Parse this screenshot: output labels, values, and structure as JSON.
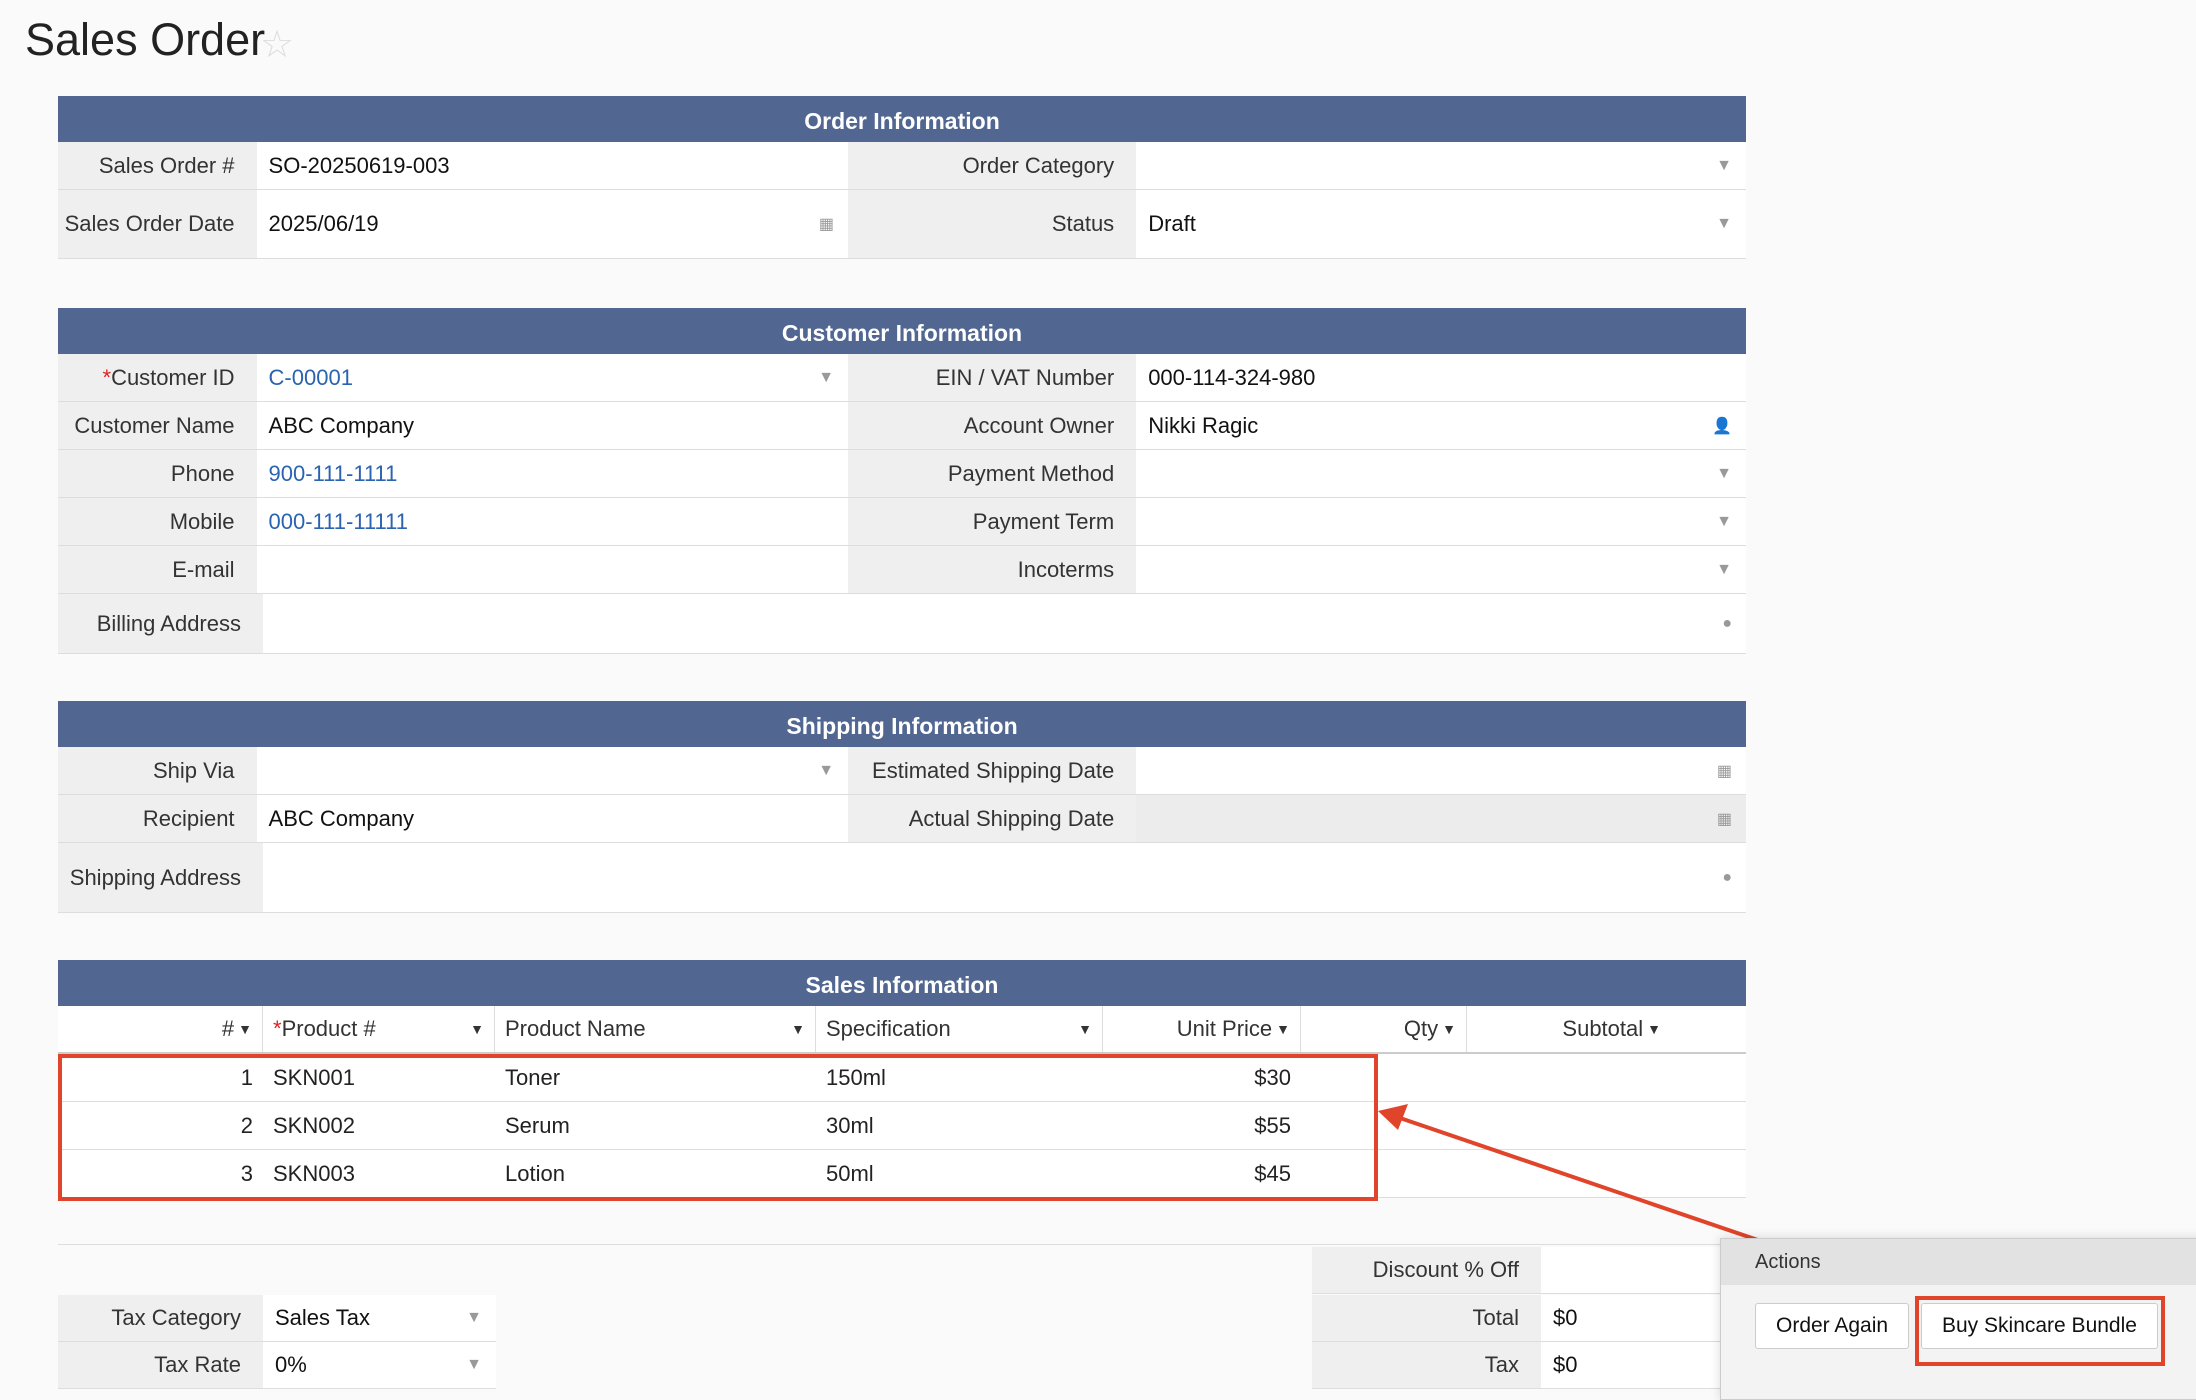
{
  "page": {
    "title": "Sales Order"
  },
  "order_info": {
    "header": "Order Information",
    "sales_order_no_label": "Sales Order #",
    "sales_order_no": "SO-20250619-003",
    "order_category_label": "Order Category",
    "order_category": "",
    "sales_order_date_label": "Sales Order Date",
    "sales_order_date": "2025/06/19",
    "status_label": "Status",
    "status": "Draft"
  },
  "customer_info": {
    "header": "Customer Information",
    "customer_id_label": "Customer ID",
    "customer_id": "C-00001",
    "ein_label": "EIN / VAT Number",
    "ein": "000-114-324-980",
    "customer_name_label": "Customer Name",
    "customer_name": "ABC Company",
    "account_owner_label": "Account Owner",
    "account_owner": "Nikki Ragic",
    "phone_label": "Phone",
    "phone": "900-111-1111",
    "payment_method_label": "Payment Method",
    "payment_method": "",
    "mobile_label": "Mobile",
    "mobile": "000-111-11111",
    "payment_term_label": "Payment Term",
    "payment_term": "",
    "email_label": "E-mail",
    "email": "",
    "incoterms_label": "Incoterms",
    "incoterms": "",
    "billing_address_label": "Billing Address",
    "billing_address": ""
  },
  "shipping_info": {
    "header": "Shipping Information",
    "ship_via_label": "Ship Via",
    "ship_via": "",
    "est_ship_date_label": "Estimated Shipping Date",
    "est_ship_date": "",
    "recipient_label": "Recipient",
    "recipient": "ABC Company",
    "actual_ship_date_label": "Actual Shipping Date",
    "actual_ship_date": "",
    "shipping_address_label": "Shipping Address",
    "shipping_address": ""
  },
  "sales_info": {
    "header": "Sales Information",
    "columns": [
      "#",
      "Product #",
      "Product Name",
      "Specification",
      "Unit Price",
      "Qty",
      "Subtotal"
    ],
    "rows": [
      {
        "no": "1",
        "product_no": "SKN001",
        "name": "Toner",
        "spec": "150ml",
        "price": "$30",
        "qty": "",
        "subtotal": ""
      },
      {
        "no": "2",
        "product_no": "SKN002",
        "name": "Serum",
        "spec": "30ml",
        "price": "$55",
        "qty": "",
        "subtotal": ""
      },
      {
        "no": "3",
        "product_no": "SKN003",
        "name": "Lotion",
        "spec": "50ml",
        "price": "$45",
        "qty": "",
        "subtotal": ""
      }
    ]
  },
  "totals": {
    "tax_category_label": "Tax Category",
    "tax_category": "Sales Tax",
    "tax_rate_label": "Tax Rate",
    "tax_rate": "0%",
    "discount_label": "Discount % Off",
    "discount": "",
    "total_label": "Total",
    "total": "$0",
    "tax_label": "Tax",
    "tax": "$0"
  },
  "actions": {
    "header": "Actions",
    "order_again": "Order Again",
    "buy_bundle": "Buy Skincare Bundle"
  },
  "colors": {
    "section_header": "#516792",
    "highlight": "#e0442a",
    "link": "#2a63b0"
  }
}
